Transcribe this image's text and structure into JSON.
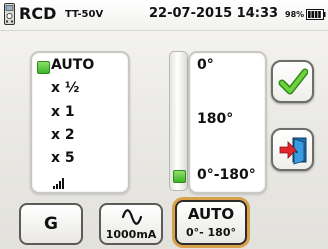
{
  "header": {
    "mode": "RCD",
    "type": "TT-50V",
    "datetime": "22-07-2015 14:33",
    "battery": "98%",
    "meter_icon": "meter-icon",
    "battery_icon": "battery-icon"
  },
  "multiplier": {
    "options": [
      "AUTO",
      "x ½",
      "x 1",
      "x 2",
      "x 5"
    ],
    "ramp_icon": "ramp-icon",
    "selected": "AUTO"
  },
  "phase": {
    "options": [
      "0°",
      "180°",
      "0°-180°"
    ],
    "selected": "0°-180°"
  },
  "buttons": {
    "confirm_icon": "checkmark-icon",
    "exit_icon": "exit-door-icon"
  },
  "toolbar": {
    "g_label": "G",
    "current_label": "1000mA",
    "current_icon": "sine-wave-icon",
    "auto_line1": "AUTO",
    "auto_line2": "0°- 180°"
  },
  "colors": {
    "selected_marker": "#3cb526",
    "confirm_check": "#58c02f",
    "exit_arrow": "#e0262b",
    "exit_door": "#2a86c8",
    "active_toolbar_outline": "#d8a24a"
  }
}
